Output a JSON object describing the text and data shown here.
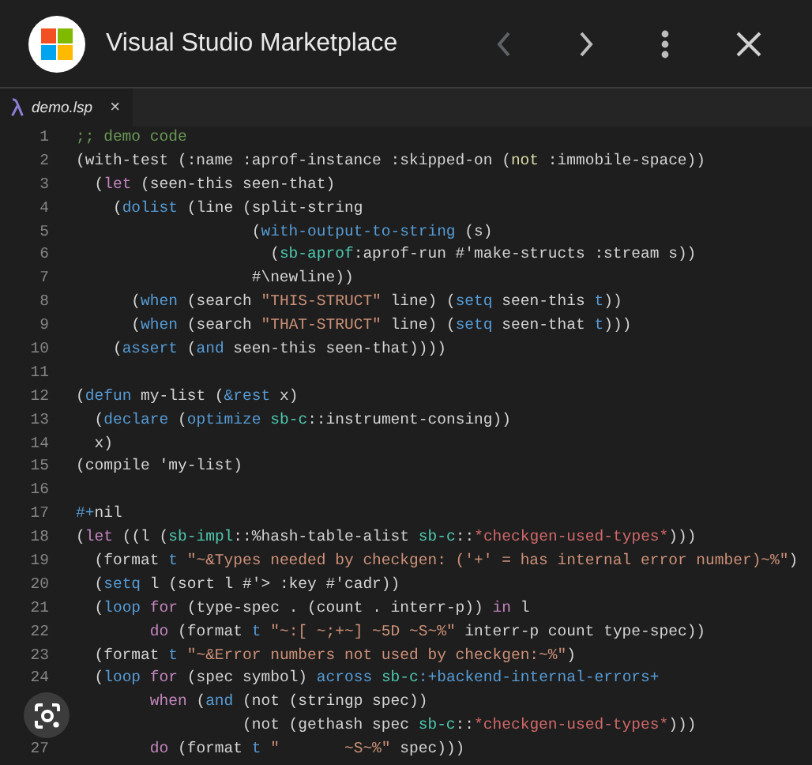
{
  "header": {
    "title": "Visual Studio Marketplace",
    "back_disabled": true
  },
  "tab": {
    "label": "demo.lsp",
    "close": "×"
  },
  "lines": [
    {
      "n": "1",
      "tokens": [
        {
          "kind": "comment",
          "text": ";; demo code"
        }
      ]
    },
    {
      "n": "2",
      "tokens": [
        {
          "kind": "plain",
          "text": "(with-test (:name :aprof-instance :skipped-on ("
        },
        {
          "kind": "fn",
          "text": "not"
        },
        {
          "kind": "plain",
          "text": " :immobile-space))"
        }
      ]
    },
    {
      "n": "3",
      "tokens": [
        {
          "kind": "plain",
          "text": "  ("
        },
        {
          "kind": "control",
          "text": "let"
        },
        {
          "kind": "plain",
          "text": " (seen-this seen-that)"
        }
      ]
    },
    {
      "n": "4",
      "tokens": [
        {
          "kind": "plain",
          "text": "    ("
        },
        {
          "kind": "keyword",
          "text": "dolist"
        },
        {
          "kind": "plain",
          "text": " (line (split-string"
        }
      ]
    },
    {
      "n": "5",
      "tokens": [
        {
          "kind": "plain",
          "text": "                   ("
        },
        {
          "kind": "keyword",
          "text": "with-output-to-string"
        },
        {
          "kind": "plain",
          "text": " (s)"
        }
      ]
    },
    {
      "n": "6",
      "tokens": [
        {
          "kind": "plain",
          "text": "                     ("
        },
        {
          "kind": "package",
          "text": "sb-aprof"
        },
        {
          "kind": "plain",
          "text": ":aprof-run #'make-structs :stream s))"
        }
      ]
    },
    {
      "n": "7",
      "tokens": [
        {
          "kind": "plain",
          "text": "                   #\\newline))"
        }
      ]
    },
    {
      "n": "8",
      "tokens": [
        {
          "kind": "plain",
          "text": "      ("
        },
        {
          "kind": "keyword",
          "text": "when"
        },
        {
          "kind": "plain",
          "text": " (search "
        },
        {
          "kind": "string",
          "text": "\"THIS-STRUCT\""
        },
        {
          "kind": "plain",
          "text": " line) ("
        },
        {
          "kind": "keyword",
          "text": "setq"
        },
        {
          "kind": "plain",
          "text": " seen-this "
        },
        {
          "kind": "keyword",
          "text": "t"
        },
        {
          "kind": "plain",
          "text": "))"
        }
      ]
    },
    {
      "n": "9",
      "tokens": [
        {
          "kind": "plain",
          "text": "      ("
        },
        {
          "kind": "keyword",
          "text": "when"
        },
        {
          "kind": "plain",
          "text": " (search "
        },
        {
          "kind": "string",
          "text": "\"THAT-STRUCT\""
        },
        {
          "kind": "plain",
          "text": " line) ("
        },
        {
          "kind": "keyword",
          "text": "setq"
        },
        {
          "kind": "plain",
          "text": " seen-that "
        },
        {
          "kind": "keyword",
          "text": "t"
        },
        {
          "kind": "plain",
          "text": ")))"
        }
      ]
    },
    {
      "n": "10",
      "tokens": [
        {
          "kind": "plain",
          "text": "    ("
        },
        {
          "kind": "keyword",
          "text": "assert"
        },
        {
          "kind": "plain",
          "text": " ("
        },
        {
          "kind": "keyword",
          "text": "and"
        },
        {
          "kind": "plain",
          "text": " seen-this seen-that))))"
        }
      ]
    },
    {
      "n": "11"
    },
    {
      "n": "12",
      "tokens": [
        {
          "kind": "plain",
          "text": "("
        },
        {
          "kind": "keyword",
          "text": "defun"
        },
        {
          "kind": "plain",
          "text": " my-list ("
        },
        {
          "kind": "keyword",
          "text": "&rest"
        },
        {
          "kind": "plain",
          "text": " x)"
        }
      ]
    },
    {
      "n": "13",
      "tokens": [
        {
          "kind": "plain",
          "text": "  ("
        },
        {
          "kind": "keyword",
          "text": "declare"
        },
        {
          "kind": "plain",
          "text": " ("
        },
        {
          "kind": "keyword",
          "text": "optimize"
        },
        {
          "kind": "package",
          "text": " sb-c"
        },
        {
          "kind": "plain",
          "text": "::instrument-consing))"
        }
      ]
    },
    {
      "n": "14",
      "tokens": [
        {
          "kind": "plain",
          "text": "  x)"
        }
      ]
    },
    {
      "n": "15",
      "tokens": [
        {
          "kind": "plain",
          "text": "(compile 'my-list)"
        }
      ]
    },
    {
      "n": "16"
    },
    {
      "n": "17",
      "tokens": [
        {
          "kind": "keyword",
          "text": "#+"
        },
        {
          "kind": "plain",
          "text": "nil"
        }
      ]
    },
    {
      "n": "18",
      "tokens": [
        {
          "kind": "plain",
          "text": "("
        },
        {
          "kind": "control",
          "text": "let"
        },
        {
          "kind": "plain",
          "text": " ((l ("
        },
        {
          "kind": "package",
          "text": "sb-impl"
        },
        {
          "kind": "plain",
          "text": "::%hash-table-alist "
        },
        {
          "kind": "package",
          "text": "sb-c"
        },
        {
          "kind": "plain",
          "text": "::"
        },
        {
          "kind": "special",
          "text": "*checkgen-used-types*"
        },
        {
          "kind": "plain",
          "text": ")))"
        }
      ]
    },
    {
      "n": "19",
      "tokens": [
        {
          "kind": "plain",
          "text": "  (format "
        },
        {
          "kind": "keyword",
          "text": "t"
        },
        {
          "kind": "string",
          "text": " \"~&Types needed by checkgen: ('+' = has internal error number)~%\""
        },
        {
          "kind": "plain",
          "text": ")"
        }
      ]
    },
    {
      "n": "20",
      "tokens": [
        {
          "kind": "plain",
          "text": "  ("
        },
        {
          "kind": "keyword",
          "text": "setq"
        },
        {
          "kind": "plain",
          "text": " l (sort l #'> :key #'cadr))"
        }
      ]
    },
    {
      "n": "21",
      "tokens": [
        {
          "kind": "plain",
          "text": "  ("
        },
        {
          "kind": "keyword",
          "text": "loop"
        },
        {
          "kind": "control",
          "text": " for"
        },
        {
          "kind": "plain",
          "text": " (type-spec . (count . interr-p)) "
        },
        {
          "kind": "control",
          "text": "in"
        },
        {
          "kind": "plain",
          "text": " l"
        }
      ]
    },
    {
      "n": "22",
      "tokens": [
        {
          "kind": "control",
          "text": "        do"
        },
        {
          "kind": "plain",
          "text": " (format "
        },
        {
          "kind": "keyword",
          "text": "t"
        },
        {
          "kind": "string",
          "text": " \"~:[ ~;+~] ~5D ~S~%\""
        },
        {
          "kind": "plain",
          "text": " interr-p count type-spec))"
        }
      ]
    },
    {
      "n": "23",
      "tokens": [
        {
          "kind": "plain",
          "text": "  (format "
        },
        {
          "kind": "keyword",
          "text": "t"
        },
        {
          "kind": "string",
          "text": " \"~&Error numbers not used by checkgen:~%\""
        },
        {
          "kind": "plain",
          "text": ")"
        }
      ]
    },
    {
      "n": "24",
      "tokens": [
        {
          "kind": "plain",
          "text": "  ("
        },
        {
          "kind": "keyword",
          "text": "loop"
        },
        {
          "kind": "control",
          "text": " for"
        },
        {
          "kind": "plain",
          "text": " (spec symbol) "
        },
        {
          "kind": "keyword",
          "text": "across"
        },
        {
          "kind": "package",
          "text": " sb-c"
        },
        {
          "kind": "keyword",
          "text": ":+backend-internal-errors+"
        }
      ]
    },
    {
      "tokens": [
        {
          "kind": "control",
          "text": "        when"
        },
        {
          "kind": "plain",
          "text": " ("
        },
        {
          "kind": "keyword",
          "text": "and"
        },
        {
          "kind": "plain",
          "text": " (not (stringp spec))"
        }
      ]
    },
    {
      "tokens": [
        {
          "kind": "plain",
          "text": "                  (not (gethash spec "
        },
        {
          "kind": "package",
          "text": "sb-c"
        },
        {
          "kind": "plain",
          "text": "::"
        },
        {
          "kind": "special",
          "text": "*checkgen-used-types*"
        },
        {
          "kind": "plain",
          "text": ")))"
        }
      ]
    },
    {
      "n": "27",
      "tokens": [
        {
          "kind": "control",
          "text": "        do"
        },
        {
          "kind": "plain",
          "text": " (format "
        },
        {
          "kind": "keyword",
          "text": "t"
        },
        {
          "kind": "string",
          "text": " \"       ~S~%\""
        },
        {
          "kind": "plain",
          "text": " spec)))"
        }
      ]
    }
  ]
}
